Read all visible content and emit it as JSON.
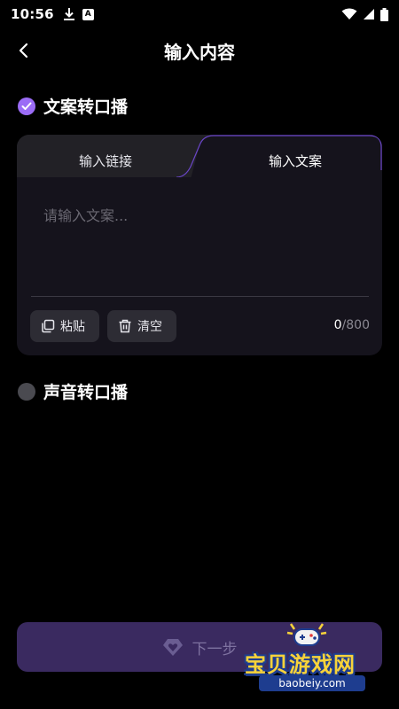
{
  "status_bar": {
    "time": "10:56",
    "icons": [
      "download-icon",
      "a-notification-icon",
      "wifi-icon",
      "signal-icon",
      "battery-icon"
    ]
  },
  "header": {
    "title": "输入内容",
    "back_icon": "chevron-left-icon"
  },
  "options": [
    {
      "label": "文案转口播",
      "selected": true
    },
    {
      "label": "声音转口播",
      "selected": false
    }
  ],
  "card": {
    "tabs": [
      {
        "label": "输入链接",
        "active": false
      },
      {
        "label": "输入文案",
        "active": true
      }
    ],
    "textarea": {
      "value": "",
      "placeholder": "请输入文案..."
    },
    "paste_label": "粘贴",
    "clear_label": "清空",
    "counter": {
      "current": "0",
      "max": "/800"
    }
  },
  "next_button": {
    "label": "下一步",
    "icon": "heart-diamond-icon"
  },
  "watermark": {
    "title": "宝贝游戏网",
    "url": "baobeiy.com"
  },
  "colors": {
    "accent": "#9b6cf6",
    "card_bg": "#15131c",
    "next_button_bg": "#3a2a60",
    "watermark_yellow": "#f7d23a",
    "watermark_blue": "#1e3d8f"
  }
}
